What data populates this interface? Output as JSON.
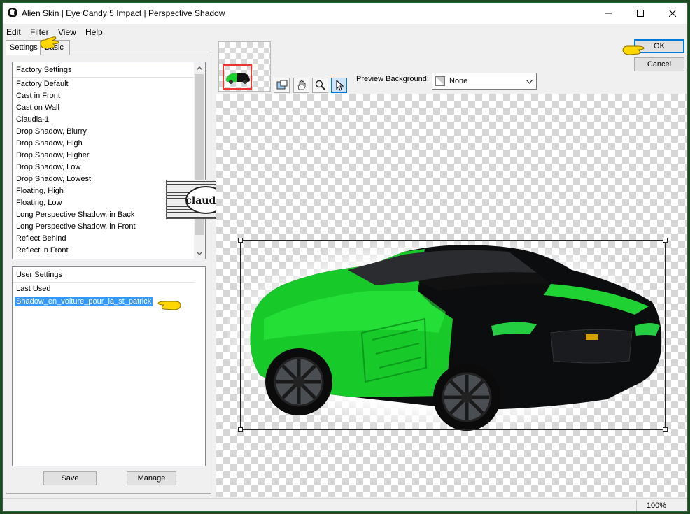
{
  "window": {
    "title": "Alien Skin | Eye Candy 5 Impact | Perspective Shadow"
  },
  "menu": [
    "Edit",
    "Filter",
    "View",
    "Help"
  ],
  "tabs": [
    "Settings",
    "Basic"
  ],
  "factory_settings": {
    "header": "Factory Settings",
    "items": [
      "Factory Default",
      "Cast in Front",
      "Cast on Wall",
      "Claudia-1",
      "Drop Shadow, Blurry",
      "Drop Shadow, High",
      "Drop Shadow, Higher",
      "Drop Shadow, Low",
      "Drop Shadow, Lowest",
      "Floating, High",
      "Floating, Low",
      "Long Perspective Shadow, in Back",
      "Long Perspective Shadow, in Front",
      "Reflect Behind",
      "Reflect in Front"
    ]
  },
  "user_settings": {
    "header": "User Settings",
    "items": [
      "Last Used",
      "Shadow_en_voiture_pour_la_st_patrick"
    ],
    "selected_index": 1
  },
  "buttons": {
    "save": "Save",
    "manage": "Manage",
    "ok": "OK",
    "cancel": "Cancel"
  },
  "preview": {
    "background_label": "Preview Background:",
    "background_value": "None"
  },
  "tools": [
    "navigator-icon",
    "hand-icon",
    "zoom-icon",
    "pointer-icon"
  ],
  "watermark_text": "claudia",
  "status": {
    "zoom": "100%"
  },
  "colors": {
    "selection": "#3399ff",
    "frame": "#2b6b33",
    "car_green": "#18c92a"
  }
}
